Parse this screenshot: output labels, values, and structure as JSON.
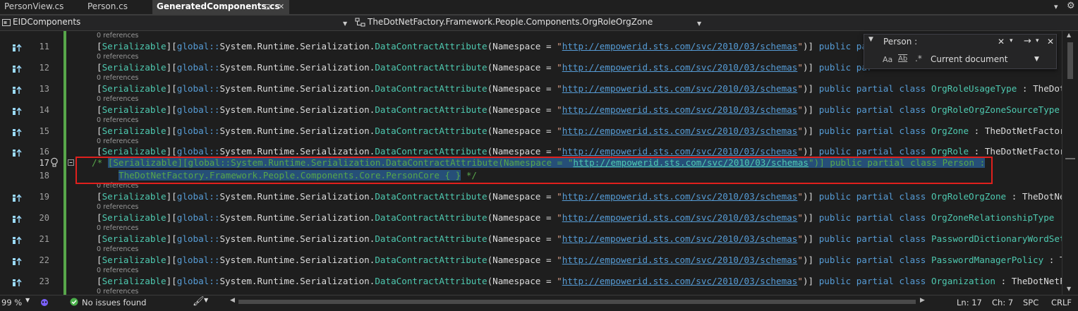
{
  "tabs": [
    {
      "label": "PersonView.cs",
      "active": false
    },
    {
      "label": "Person.cs",
      "active": false
    },
    {
      "label": "GeneratedComponents.cs",
      "active": true,
      "pin": "⊡",
      "close": "✕"
    }
  ],
  "tabbar": {
    "overflow": "▾",
    "settings": "⚙"
  },
  "navbar": {
    "project": "EIDComponents",
    "type": "TheDotNetFactory.Framework.People.Components.OrgRoleOrgZone",
    "member": ""
  },
  "find": {
    "query": "Person :",
    "close": "✕",
    "options_caret": "▾",
    "find_next": "→",
    "find_options": "▾",
    "widget_close": "✕",
    "match_case": "Aa",
    "whole_word": "Ab",
    "regex": ".*",
    "scope": "Current document"
  },
  "code": {
    "refs_label": "0 references",
    "attr_serializable": "Serializable",
    "global_prefix": "global::",
    "namespace_path": "System.Runtime.Serialization.",
    "dca": "DataContractAttribute",
    "ns_param": "(Namespace = ",
    "url": "http://empowerid.sts.com/svc/2010/03/schemas",
    "after_url": ")] ",
    "public": "public",
    "partial": "partial",
    "class": "class",
    "colon": " : ",
    "lines": [
      {
        "num": "11",
        "name": "",
        "base": ""
      },
      {
        "num": "12",
        "name": "",
        "base": ""
      },
      {
        "num": "13",
        "name": "OrgRoleUsageType",
        "base": "TheDot"
      },
      {
        "num": "14",
        "name": "OrgRoleOrgZoneSourceType",
        "base": ""
      },
      {
        "num": "15",
        "name": "OrgZone",
        "base": "TheDotNetFactor"
      },
      {
        "num": "16",
        "name": "OrgRole",
        "base": "TheDotNetFactor"
      },
      {
        "num": "19",
        "name": "OrgRoleOrgZone",
        "base": "TheDotNe"
      },
      {
        "num": "20",
        "name": "OrgZoneRelationshipType",
        "base": ""
      },
      {
        "num": "21",
        "name": "PasswordDictionaryWordSet",
        "base": ""
      },
      {
        "num": "22",
        "name": "PasswordManagerPolicy",
        "base": "T"
      },
      {
        "num": "23",
        "name": "Organization",
        "base": "TheDotNetF"
      }
    ],
    "line17_num": "17",
    "line18_num": "18",
    "comment_open": "/* ",
    "line17_text": "[Serializable][global::System.Runtime.Serialization.DataContractAttribute(Namespace = \"",
    "line17_text_b": "\")] public partial class Person :",
    "line18_text": "TheDotNetFactory.Framework.People.Components.Core.PersonCore { }",
    "comment_close": " */",
    "truncated_tail": "public par"
  },
  "status": {
    "zoom": "99 %",
    "issues": "No issues found",
    "line": "Ln: 17",
    "col": "Ch: 7",
    "spc": "SPC",
    "crlf": "CRLF"
  },
  "colors": {
    "keyword": "#569cd6",
    "type": "#4ec9b0",
    "string": "#d69d85",
    "comment": "#57a64a",
    "selection": "#264f78",
    "highlight_box": "#e0201d"
  }
}
